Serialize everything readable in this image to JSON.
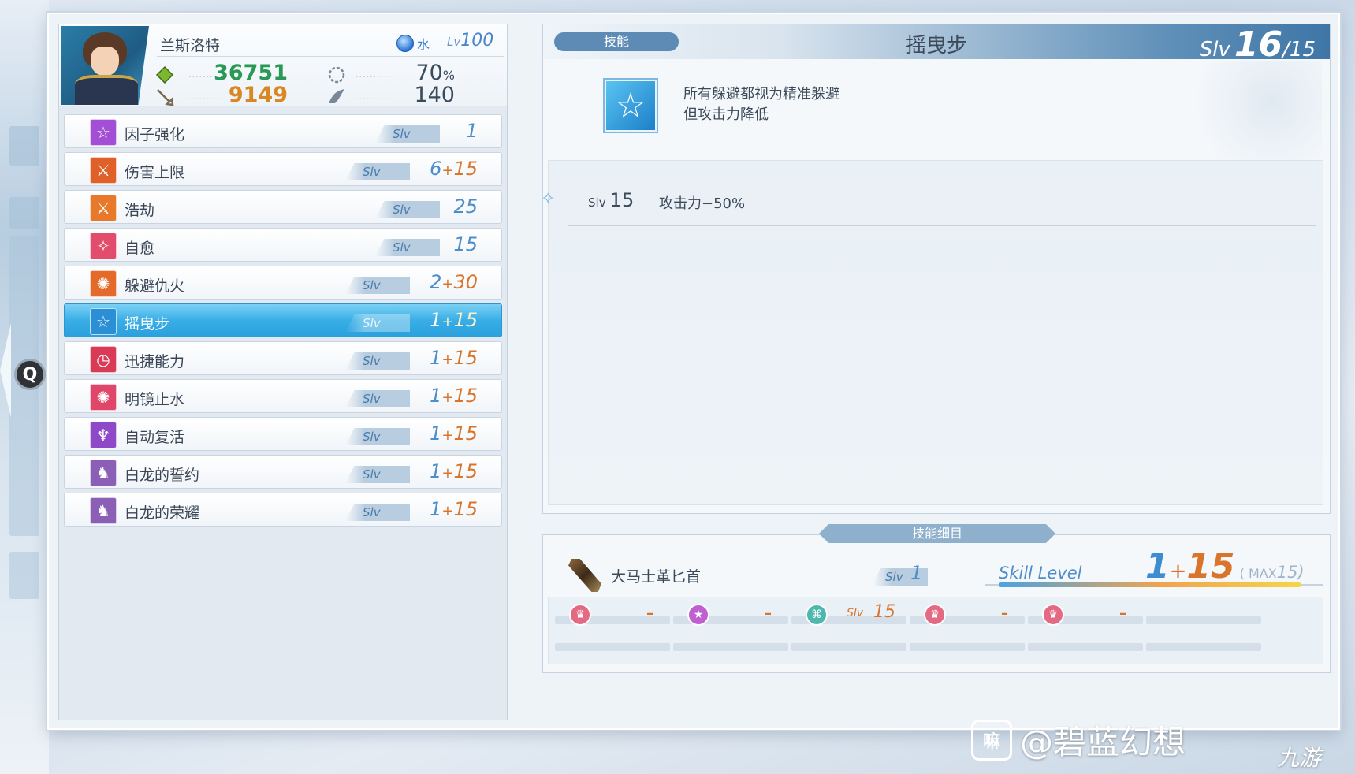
{
  "character": {
    "name": "兰斯洛特",
    "element": "水",
    "level_prefix": "Lv",
    "level": "100",
    "hp": "36751",
    "atk": "9149",
    "stat_right_1": "70",
    "stat_right_1_unit": "%",
    "stat_right_2": "140"
  },
  "skills": [
    {
      "name": "因子强化",
      "base": "1",
      "bonus": "",
      "icon": "star-outline-icon",
      "color": "#a24fd6"
    },
    {
      "name": "伤害上限",
      "base": "6",
      "bonus": "15",
      "icon": "swords-icon",
      "color": "#e0602a"
    },
    {
      "name": "浩劫",
      "base": "25",
      "bonus": "",
      "icon": "sword-icon",
      "color": "#e8782a"
    },
    {
      "name": "自愈",
      "base": "15",
      "bonus": "",
      "icon": "sparkle-icon",
      "color": "#e34d6d"
    },
    {
      "name": "躲避仇火",
      "base": "2",
      "bonus": "30",
      "icon": "burst-icon",
      "color": "#e36a2a"
    },
    {
      "name": "摇曳步",
      "base": "1",
      "bonus": "15",
      "icon": "star-outline-icon",
      "color": "#2b8fd6"
    },
    {
      "name": "迅捷能力",
      "base": "1",
      "bonus": "15",
      "icon": "clock-icon",
      "color": "#d93a55"
    },
    {
      "name": "明镜止水",
      "base": "1",
      "bonus": "15",
      "icon": "burst-icon",
      "color": "#e0456a"
    },
    {
      "name": "自动复活",
      "base": "1",
      "bonus": "15",
      "icon": "angel-icon",
      "color": "#8e49c9"
    },
    {
      "name": "白龙的誓约",
      "base": "1",
      "bonus": "15",
      "icon": "dragon-icon",
      "color": "#8a5fb5"
    },
    {
      "name": "白龙的荣耀",
      "base": "1",
      "bonus": "15",
      "icon": "dragon-icon",
      "color": "#8a5fb5"
    }
  ],
  "slv_label": "Slv",
  "selected_index": 5,
  "detail": {
    "tab_label": "技能",
    "title": "摇曳步",
    "slv_label": "Slv",
    "slv_current": "16",
    "slv_max": "/15",
    "description_line1": "所有躲避都视为精准躲避",
    "description_line2": "但攻击力降低",
    "effect_slv": "15",
    "effect_text": "攻击力−50%"
  },
  "sub": {
    "tab_label": "技能细目",
    "weapon_name": "大马士革匕首",
    "weapon_slv": "1",
    "skill_level_label": "Skill Level",
    "skill_level_base": "1",
    "skill_level_plus": "+",
    "skill_level_bonus": "15",
    "skill_level_max_label": "( MAX",
    "skill_level_max": "15)",
    "skill_level_fill": 0.96,
    "slots": [
      {
        "icon": "crown-gem-icon",
        "color": "#e46a84",
        "value": "–",
        "slv": ""
      },
      {
        "icon": "star-gem-icon",
        "color": "#c060d0",
        "value": "–",
        "slv": ""
      },
      {
        "icon": "pattern-gem-icon",
        "color": "#4fb6b0",
        "value": "15",
        "slv": "Slv"
      },
      {
        "icon": "crown-gem-icon",
        "color": "#e46a84",
        "value": "–",
        "slv": ""
      },
      {
        "icon": "crown-gem-icon",
        "color": "#e46a84",
        "value": "–",
        "slv": ""
      },
      {
        "icon": "",
        "color": "",
        "value": "",
        "slv": ""
      }
    ]
  },
  "q_button": "Q",
  "watermark": {
    "logo": "嘛",
    "text": "@碧蓝幻想",
    "site": "九游"
  }
}
